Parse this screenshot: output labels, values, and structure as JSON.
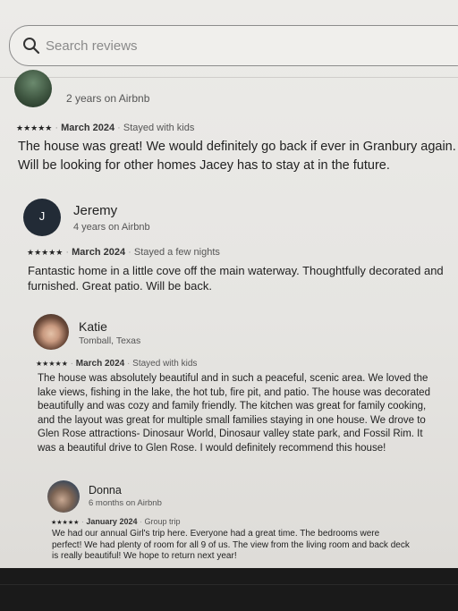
{
  "search": {
    "placeholder": "Search reviews"
  },
  "reviews": [
    {
      "since": "2 years on Airbnb",
      "stars": "★★★★★",
      "date": "March 2024",
      "trip": "Stayed with kids",
      "text": "The house was great! We would definitely go back if ever in Granbury again. Will be looking for other homes Jacey has to stay at in the future."
    },
    {
      "initial": "J",
      "name": "Jeremy",
      "since": "4 years on Airbnb",
      "stars": "★★★★★",
      "date": "March 2024",
      "trip": "Stayed a few nights",
      "text": "Fantastic home in a little cove off the main waterway. Thoughtfully decorated and furnished. Great patio. Will be back."
    },
    {
      "name": "Katie",
      "since": "Tomball, Texas",
      "stars": "★★★★★",
      "date": "March 2024",
      "trip": "Stayed with kids",
      "text": "The house was absolutely beautiful and in such a peaceful, scenic area. We loved the lake views, fishing in the lake, the hot tub, fire pit, and patio. The house was decorated beautifully and was cozy and family friendly. The kitchen was great for family cooking, and the layout was great for multiple small families staying in one house. We drove to Glen Rose attractions- Dinosaur World, Dinosaur valley state park, and Fossil Rim. It was a beautiful drive to Glen Rose. I would definitely recommend this house!"
    },
    {
      "name": "Donna",
      "since": "6 months on Airbnb",
      "stars": "★★★★★",
      "date": "January 2024",
      "trip": "Group trip",
      "text": "We had our annual Girl's trip here. Everyone had a great time. The bedrooms were perfect! We had plenty of room for all 9 of us. The view from the living room and back deck is really beautiful! We hope to return next year!"
    }
  ],
  "separator": "·"
}
